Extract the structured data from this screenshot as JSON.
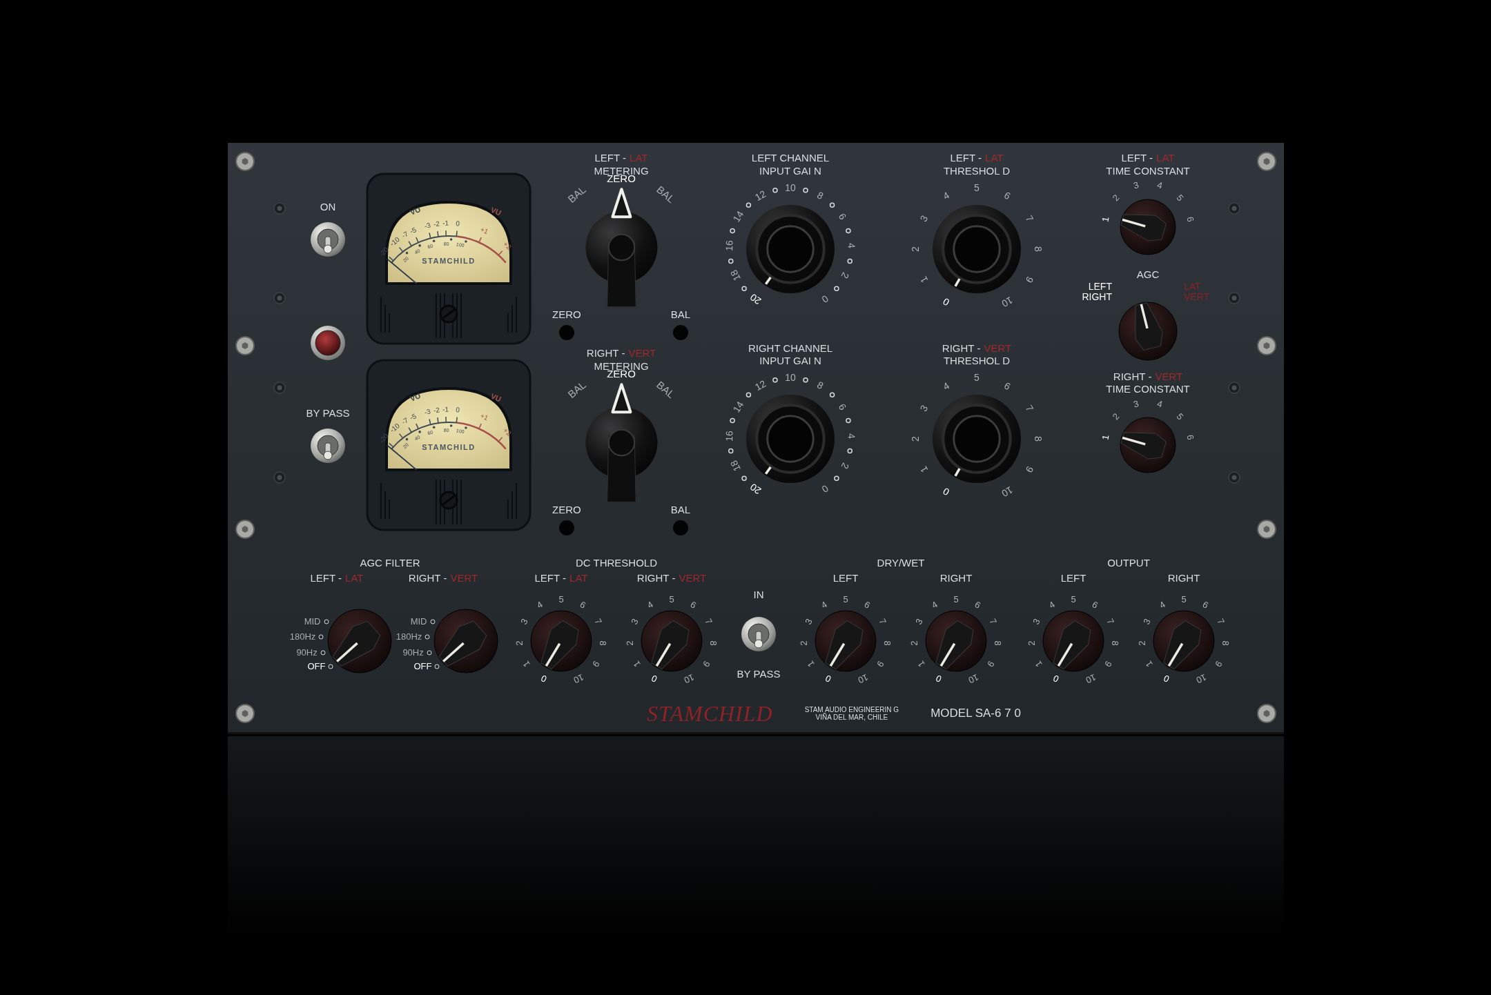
{
  "switches": {
    "power_label": "ON",
    "power_on": true,
    "bypass_label": "BY PASS",
    "bypass_on": true
  },
  "meters": [
    {
      "vu_left": "VU",
      "vu_right": "VU",
      "scale": [
        "-20",
        "-10",
        "-7",
        "-5",
        "-3",
        "-2",
        "-1",
        "0",
        "+1",
        "+2"
      ],
      "sub_scale": [
        "20",
        "40",
        "60",
        "80",
        "100"
      ],
      "brand": "STAMCHILD"
    },
    {
      "vu_left": "VU",
      "vu_right": "VU",
      "scale": [
        "-20",
        "-10",
        "-7",
        "-5",
        "-3",
        "-2",
        "-1",
        "0",
        "+1",
        "+2"
      ],
      "sub_scale": [
        "20",
        "40",
        "60",
        "80",
        "100"
      ],
      "brand": "STAMCHILD"
    }
  ],
  "metering": [
    {
      "title": [
        {
          "text": "LEFT -",
          "accent": "LAT"
        },
        {
          "text": "METERING"
        }
      ],
      "options": [
        {
          "label": "BAL",
          "selected": false
        },
        {
          "label": "ZERO",
          "selected": true
        },
        {
          "label": "BAL",
          "selected": false
        }
      ],
      "jacks": [
        "ZERO",
        "BAL"
      ]
    },
    {
      "title": [
        {
          "text": "RIGHT -",
          "accent": "VERT"
        },
        {
          "text": "METERING"
        }
      ],
      "options": [
        {
          "label": "BAL",
          "selected": false
        },
        {
          "label": "ZERO",
          "selected": true
        },
        {
          "label": "BAL",
          "selected": false
        }
      ],
      "jacks": [
        "ZERO",
        "BAL"
      ]
    }
  ],
  "input_gain": [
    {
      "title": [
        {
          "text": "LEFT CHANNEL"
        },
        {
          "text": "INPUT GAI N"
        }
      ],
      "scale": [
        {
          "label": "20",
          "selected": true
        },
        {
          "label": "18",
          "selected": false
        },
        {
          "label": "16",
          "selected": false
        },
        {
          "label": "14",
          "selected": false
        },
        {
          "label": "12",
          "selected": false
        },
        {
          "label": "10",
          "selected": false
        },
        {
          "label": "8",
          "selected": false
        },
        {
          "label": "6",
          "selected": false
        },
        {
          "label": "4",
          "selected": false
        },
        {
          "label": "2",
          "selected": false
        },
        {
          "label": "0",
          "selected": false
        }
      ]
    },
    {
      "title": [
        {
          "text": "RIGHT CHANNEL"
        },
        {
          "text": "INPUT GAI N"
        }
      ],
      "scale": [
        {
          "label": "20",
          "selected": true
        },
        {
          "label": "18",
          "selected": false
        },
        {
          "label": "16",
          "selected": false
        },
        {
          "label": "14",
          "selected": false
        },
        {
          "label": "12",
          "selected": false
        },
        {
          "label": "10",
          "selected": false
        },
        {
          "label": "8",
          "selected": false
        },
        {
          "label": "6",
          "selected": false
        },
        {
          "label": "4",
          "selected": false
        },
        {
          "label": "2",
          "selected": false
        },
        {
          "label": "0",
          "selected": false
        }
      ]
    }
  ],
  "threshold": [
    {
      "title": [
        {
          "text": "LEFT -",
          "accent": "LAT"
        },
        {
          "text": "THRESHOL D"
        }
      ],
      "scale": [
        {
          "label": "0",
          "selected": true
        },
        {
          "label": "1",
          "selected": false
        },
        {
          "label": "2",
          "selected": false
        },
        {
          "label": "3",
          "selected": false
        },
        {
          "label": "4",
          "selected": false
        },
        {
          "label": "5",
          "selected": false
        },
        {
          "label": "6",
          "selected": false
        },
        {
          "label": "7",
          "selected": false
        },
        {
          "label": "8",
          "selected": false
        },
        {
          "label": "9",
          "selected": false
        },
        {
          "label": "10",
          "selected": false
        }
      ]
    },
    {
      "title": [
        {
          "text": "RIGHT -",
          "accent": "VERT"
        },
        {
          "text": "THRESHOL D"
        }
      ],
      "scale": [
        {
          "label": "0",
          "selected": true
        },
        {
          "label": "1",
          "selected": false
        },
        {
          "label": "2",
          "selected": false
        },
        {
          "label": "3",
          "selected": false
        },
        {
          "label": "4",
          "selected": false
        },
        {
          "label": "5",
          "selected": false
        },
        {
          "label": "6",
          "selected": false
        },
        {
          "label": "7",
          "selected": false
        },
        {
          "label": "8",
          "selected": false
        },
        {
          "label": "9",
          "selected": false
        },
        {
          "label": "10",
          "selected": false
        }
      ]
    }
  ],
  "time_constant": [
    {
      "title": [
        {
          "text": "LEFT -",
          "accent": "LAT"
        },
        {
          "text": "TIME CONSTANT"
        }
      ],
      "scale": [
        {
          "label": "1",
          "selected": true
        },
        {
          "label": "2",
          "selected": false
        },
        {
          "label": "3",
          "selected": false
        },
        {
          "label": "4",
          "selected": false
        },
        {
          "label": "5",
          "selected": false
        },
        {
          "label": "6",
          "selected": false
        }
      ]
    },
    {
      "title": [
        {
          "text": "RIGHT -",
          "accent": "VERT"
        },
        {
          "text": "TIME CONSTANT"
        }
      ],
      "scale": [
        {
          "label": "1",
          "selected": true
        },
        {
          "label": "2",
          "selected": false
        },
        {
          "label": "3",
          "selected": false
        },
        {
          "label": "4",
          "selected": false
        },
        {
          "label": "5",
          "selected": false
        },
        {
          "label": "6",
          "selected": false
        }
      ]
    }
  ],
  "agc": {
    "title": "AGC",
    "options": [
      {
        "lines": [
          "LEFT",
          "RIGHT"
        ],
        "accent": false,
        "selected": true
      },
      {
        "lines": [
          "LAT",
          "VERT"
        ],
        "accent": true,
        "selected": false
      }
    ]
  },
  "agc_filter": {
    "title": "AGC FILTER",
    "knobs": [
      {
        "label": {
          "text": "LEFT -",
          "accent": "LAT"
        },
        "options": [
          {
            "label": "MID",
            "selected": false
          },
          {
            "label": "180Hz",
            "selected": false
          },
          {
            "label": "90Hz",
            "selected": false
          },
          {
            "label": "OFF",
            "selected": true
          }
        ]
      },
      {
        "label": {
          "text": "RIGHT -",
          "accent": "VERT"
        },
        "options": [
          {
            "label": "MID",
            "selected": false
          },
          {
            "label": "180Hz",
            "selected": false
          },
          {
            "label": "90Hz",
            "selected": false
          },
          {
            "label": "OFF",
            "selected": true
          }
        ]
      }
    ]
  },
  "dc_threshold": {
    "title": "DC THRESHOLD",
    "knobs": [
      {
        "label": {
          "text": "LEFT -",
          "accent": "LAT"
        },
        "scale": [
          {
            "label": "0",
            "selected": true
          },
          {
            "label": "1",
            "selected": false
          },
          {
            "label": "2",
            "selected": false
          },
          {
            "label": "3",
            "selected": false
          },
          {
            "label": "4",
            "selected": false
          },
          {
            "label": "5",
            "selected": false
          },
          {
            "label": "6",
            "selected": false
          },
          {
            "label": "7",
            "selected": false
          },
          {
            "label": "8",
            "selected": false
          },
          {
            "label": "9",
            "selected": false
          },
          {
            "label": "10",
            "selected": false
          }
        ]
      },
      {
        "label": {
          "text": "RIGHT -",
          "accent": "VERT"
        },
        "scale": [
          {
            "label": "0",
            "selected": true
          },
          {
            "label": "1",
            "selected": false
          },
          {
            "label": "2",
            "selected": false
          },
          {
            "label": "3",
            "selected": false
          },
          {
            "label": "4",
            "selected": false
          },
          {
            "label": "5",
            "selected": false
          },
          {
            "label": "6",
            "selected": false
          },
          {
            "label": "7",
            "selected": false
          },
          {
            "label": "8",
            "selected": false
          },
          {
            "label": "9",
            "selected": false
          },
          {
            "label": "10",
            "selected": false
          }
        ]
      }
    ]
  },
  "bypass": {
    "top_label": "IN",
    "on": true,
    "bottom_label": "BY PASS"
  },
  "dry_wet": {
    "title": "DRY/WET",
    "knobs": [
      {
        "label": {
          "text": "LEFT"
        },
        "scale": [
          {
            "label": "0",
            "selected": true
          },
          {
            "label": "1",
            "selected": false
          },
          {
            "label": "2",
            "selected": false
          },
          {
            "label": "3",
            "selected": false
          },
          {
            "label": "4",
            "selected": false
          },
          {
            "label": "5",
            "selected": false
          },
          {
            "label": "6",
            "selected": false
          },
          {
            "label": "7",
            "selected": false
          },
          {
            "label": "8",
            "selected": false
          },
          {
            "label": "9",
            "selected": false
          },
          {
            "label": "10",
            "selected": false
          }
        ]
      },
      {
        "label": {
          "text": "RIGHT"
        },
        "scale": [
          {
            "label": "0",
            "selected": true
          },
          {
            "label": "1",
            "selected": false
          },
          {
            "label": "2",
            "selected": false
          },
          {
            "label": "3",
            "selected": false
          },
          {
            "label": "4",
            "selected": false
          },
          {
            "label": "5",
            "selected": false
          },
          {
            "label": "6",
            "selected": false
          },
          {
            "label": "7",
            "selected": false
          },
          {
            "label": "8",
            "selected": false
          },
          {
            "label": "9",
            "selected": false
          },
          {
            "label": "10",
            "selected": false
          }
        ]
      }
    ]
  },
  "output": {
    "title": "OUTPUT",
    "knobs": [
      {
        "label": {
          "text": "LEFT"
        },
        "scale": [
          {
            "label": "0",
            "selected": true
          },
          {
            "label": "1",
            "selected": false
          },
          {
            "label": "2",
            "selected": false
          },
          {
            "label": "3",
            "selected": false
          },
          {
            "label": "4",
            "selected": false
          },
          {
            "label": "5",
            "selected": false
          },
          {
            "label": "6",
            "selected": false
          },
          {
            "label": "7",
            "selected": false
          },
          {
            "label": "8",
            "selected": false
          },
          {
            "label": "9",
            "selected": false
          },
          {
            "label": "10",
            "selected": false
          }
        ]
      },
      {
        "label": {
          "text": "RIGHT"
        },
        "scale": [
          {
            "label": "0",
            "selected": true
          },
          {
            "label": "1",
            "selected": false
          },
          {
            "label": "2",
            "selected": false
          },
          {
            "label": "3",
            "selected": false
          },
          {
            "label": "4",
            "selected": false
          },
          {
            "label": "5",
            "selected": false
          },
          {
            "label": "6",
            "selected": false
          },
          {
            "label": "7",
            "selected": false
          },
          {
            "label": "8",
            "selected": false
          },
          {
            "label": "9",
            "selected": false
          },
          {
            "label": "10",
            "selected": false
          }
        ]
      }
    ]
  },
  "footer": {
    "logo": "STAMCHILD",
    "maker": [
      "STAM AUDIO ENGINEERIN G",
      "VIÑA DEL MAR, CHILE"
    ],
    "model": "MODEL SA-6 7 0"
  }
}
